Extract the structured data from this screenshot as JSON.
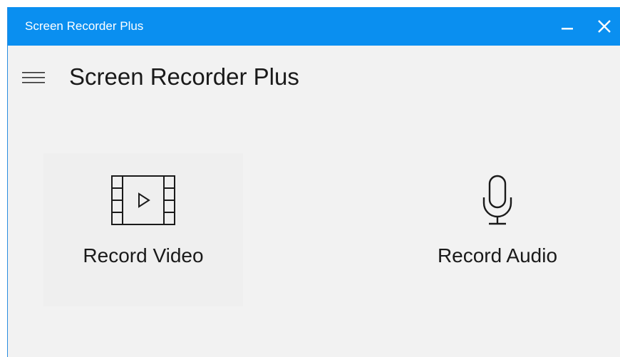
{
  "window": {
    "title": "Screen Recorder Plus",
    "titlebar_color": "#0a8ff0"
  },
  "titlebar": {
    "minimize_icon": "minimize-icon",
    "close_icon": "close-icon"
  },
  "header": {
    "menu_icon": "hamburger-menu-icon",
    "app_title": "Screen Recorder Plus"
  },
  "actions": [
    {
      "label": "Record Video",
      "icon": "film-play-icon"
    },
    {
      "label": "Record Audio",
      "icon": "microphone-icon"
    }
  ]
}
